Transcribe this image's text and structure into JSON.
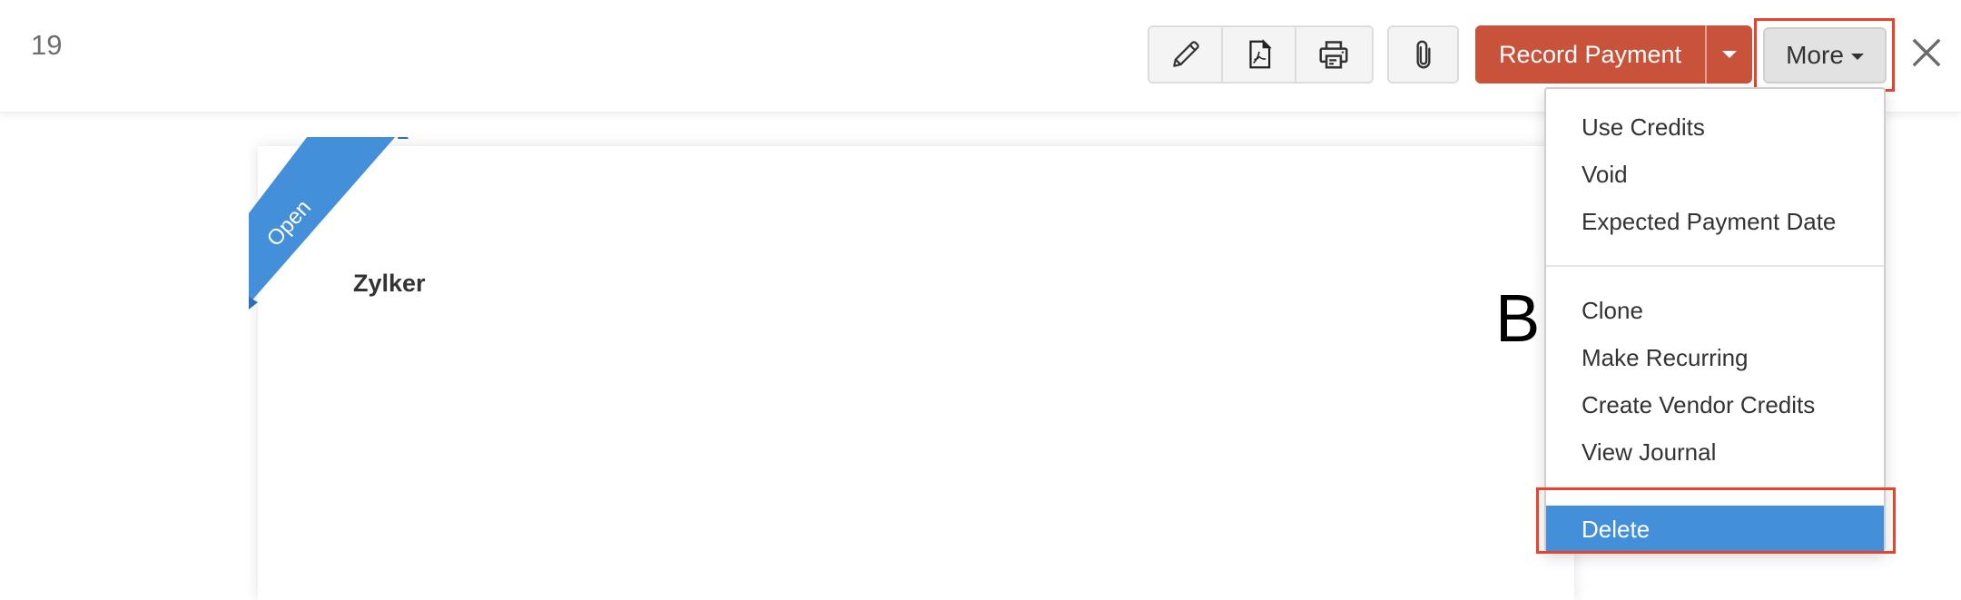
{
  "header": {
    "record_number": "19",
    "toolbar": {
      "edit_icon": "pencil-icon",
      "pdf_icon": "pdf-file-icon",
      "print_icon": "printer-icon",
      "attach_icon": "paperclip-icon",
      "record_payment_label": "Record Payment",
      "record_payment_caret": "caret-down-icon",
      "more_label": "More",
      "close_icon": "close-icon"
    },
    "colors": {
      "primary_button": "#c8523a",
      "highlight_box": "#e8432b",
      "menu_active": "#448fda",
      "ribbon": "#448fda"
    }
  },
  "document": {
    "status_ribbon": "Open",
    "company_name": "Zylker",
    "title_fragment": "B"
  },
  "more_menu": {
    "groups": [
      {
        "items": [
          {
            "label": "Use Credits"
          },
          {
            "label": "Void"
          },
          {
            "label": "Expected Payment Date"
          }
        ]
      },
      {
        "items": [
          {
            "label": "Clone"
          },
          {
            "label": "Make Recurring"
          },
          {
            "label": "Create Vendor Credits"
          },
          {
            "label": "View Journal"
          }
        ]
      },
      {
        "items": [
          {
            "label": "Delete",
            "active": true
          }
        ]
      }
    ]
  }
}
